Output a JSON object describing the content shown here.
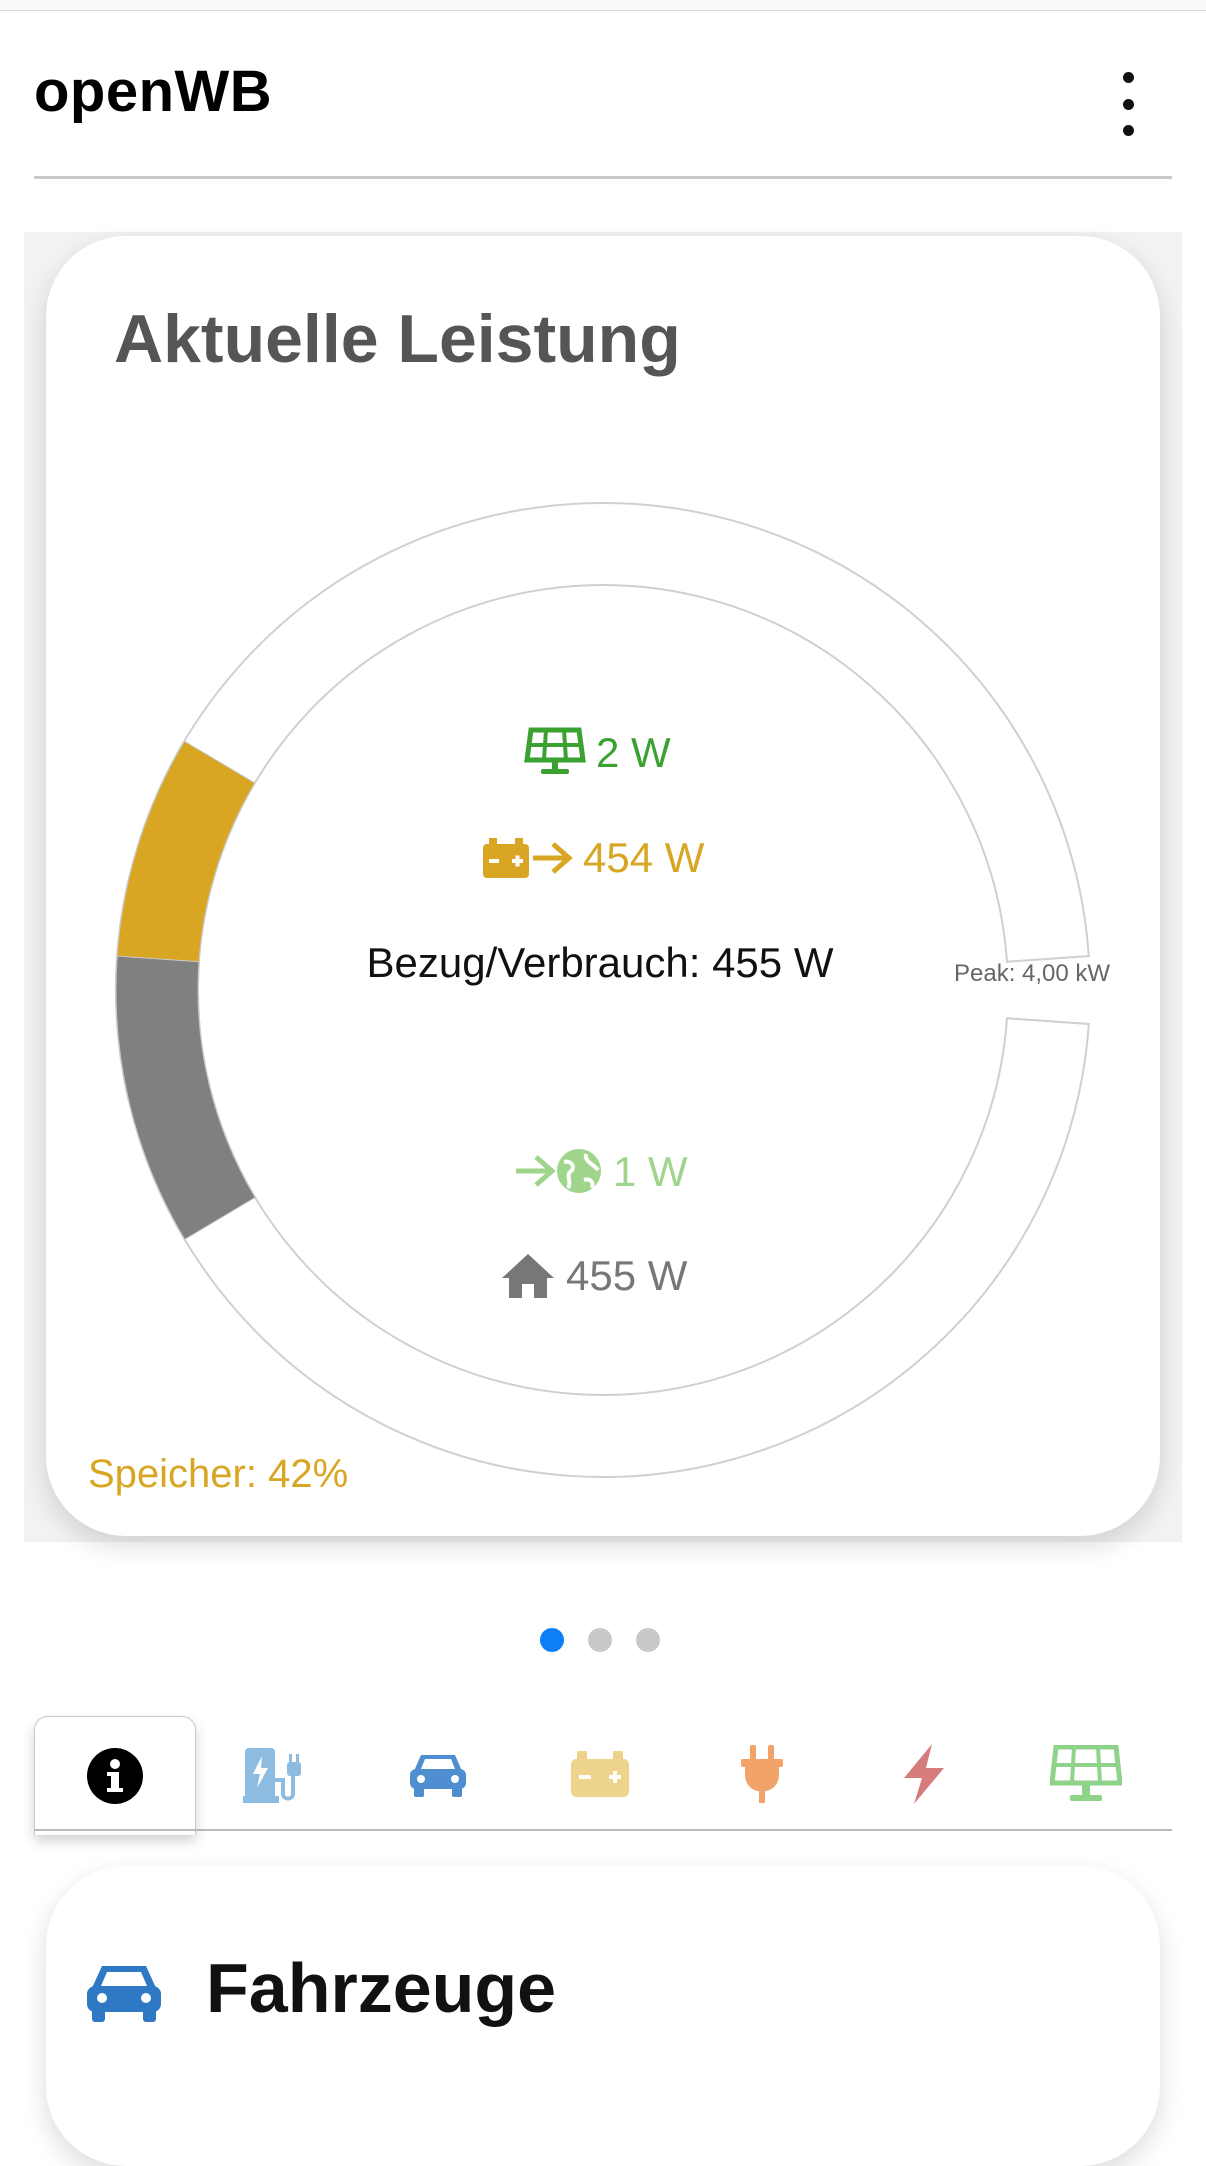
{
  "app": {
    "title": "openWB"
  },
  "power_card": {
    "title": "Aktuelle Leistung",
    "pv_value": "2 W",
    "battery_value": "454 W",
    "center_label": "Bezug/Verbrauch: 455 W",
    "grid_value": "1 W",
    "house_value": "455 W",
    "peak_label": "Peak: 4,00 kW",
    "storage_label": "Speicher: 42%"
  },
  "chart_data": {
    "type": "donut-gauge",
    "peak_kw": 4.0,
    "top_arc": {
      "name": "source",
      "segments": [
        {
          "label": "battery",
          "value_w": 454,
          "color": "#D8A622"
        },
        {
          "label": "pv",
          "value_w": 2,
          "color": "#3BA231"
        }
      ]
    },
    "bottom_arc": {
      "name": "usage",
      "segments": [
        {
          "label": "house",
          "value_w": 455,
          "color": "#808080"
        }
      ]
    }
  },
  "colors": {
    "pv": "#3BA231",
    "battery": "#D8A622",
    "grid": "#9ED58A",
    "house": "#777777",
    "dot_active": "#0D7FF5",
    "dot_inactive": "#C8C8C8",
    "charge_point": "#8EBCE0",
    "vehicle": "#4F8FD1",
    "plug": "#F2A36A",
    "counter": "#D77C7C",
    "solar_light": "#8FD28A"
  },
  "carousel": {
    "active_index": 0,
    "count": 3
  },
  "tabs": [
    {
      "name": "tab-info",
      "icon": "info-icon",
      "active": true
    },
    {
      "name": "tab-chargepoints",
      "icon": "charging-station-icon",
      "active": false
    },
    {
      "name": "tab-vehicles",
      "icon": "car-icon",
      "active": false
    },
    {
      "name": "tab-battery",
      "icon": "battery-icon",
      "active": false
    },
    {
      "name": "tab-devices",
      "icon": "plug-icon",
      "active": false
    },
    {
      "name": "tab-counters",
      "icon": "bolt-icon",
      "active": false
    },
    {
      "name": "tab-pv",
      "icon": "solar-panel-icon",
      "active": false
    }
  ],
  "vehicles_card": {
    "title": "Fahrzeuge"
  }
}
